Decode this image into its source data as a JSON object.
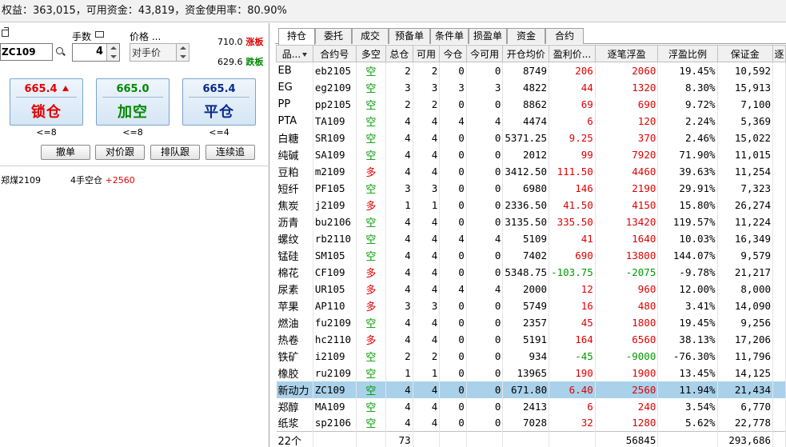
{
  "account_bar": "权益：363,015，可用资金：43,819，资金使用率：80.90%",
  "order": {
    "code": "ZC109",
    "qty_label": "手数",
    "qty": "4",
    "price_label": "价格 ...",
    "price_mode": "对手价",
    "limit_up_price": "710.0",
    "limit_up_tag": "涨板",
    "limit_down_price": "629.6",
    "limit_down_tag": "跌板",
    "buttons": [
      {
        "price": "665.4",
        "action": "锁仓",
        "cond": "<=8"
      },
      {
        "price": "665.0",
        "action": "加空",
        "cond": "<=8"
      },
      {
        "price": "665.4",
        "action": "平仓",
        "cond": "<=4"
      }
    ],
    "small_buttons": [
      "撤单",
      "对价跟",
      "排队跟",
      "连续追"
    ],
    "position_line": {
      "name": "郑煤2109",
      "desc": "4手空仓",
      "pnl": "+2560"
    }
  },
  "tabs": [
    "持仓",
    "委托",
    "成交",
    "预备单",
    "条件单",
    "损盈单",
    "资金",
    "合约"
  ],
  "columns": [
    "品...",
    "合约号",
    "多空",
    "总仓",
    "可用",
    "今仓",
    "今可用",
    "开仓均价",
    "盈利价...",
    "逐笔浮盈",
    "浮盈比例",
    "保证金",
    "逐"
  ],
  "rows": [
    [
      "EB",
      "eb2105",
      "空",
      "2",
      "2",
      "0",
      "0",
      "8749",
      "206",
      "2060",
      "19.45%",
      "10,592"
    ],
    [
      "EG",
      "eg2109",
      "空",
      "3",
      "3",
      "3",
      "3",
      "4822",
      "44",
      "1320",
      "8.30%",
      "15,913"
    ],
    [
      "PP",
      "pp2105",
      "空",
      "2",
      "2",
      "0",
      "0",
      "8862",
      "69",
      "690",
      "9.72%",
      "7,100"
    ],
    [
      "PTA",
      "TA109",
      "空",
      "4",
      "4",
      "4",
      "4",
      "4474",
      "6",
      "120",
      "2.24%",
      "5,369"
    ],
    [
      "白糖",
      "SR109",
      "空",
      "4",
      "4",
      "0",
      "0",
      "5371.25",
      "9.25",
      "370",
      "2.46%",
      "15,022"
    ],
    [
      "纯碱",
      "SA109",
      "空",
      "4",
      "4",
      "0",
      "0",
      "2012",
      "99",
      "7920",
      "71.90%",
      "11,015"
    ],
    [
      "豆粕",
      "m2109",
      "多",
      "4",
      "4",
      "0",
      "0",
      "3412.50",
      "111.50",
      "4460",
      "39.63%",
      "11,254"
    ],
    [
      "短纤",
      "PF105",
      "空",
      "3",
      "3",
      "0",
      "0",
      "6980",
      "146",
      "2190",
      "29.91%",
      "7,323"
    ],
    [
      "焦炭",
      "j2109",
      "多",
      "1",
      "1",
      "0",
      "0",
      "2336.50",
      "41.50",
      "4150",
      "15.80%",
      "26,274"
    ],
    [
      "沥青",
      "bu2106",
      "空",
      "4",
      "4",
      "0",
      "0",
      "3135.50",
      "335.50",
      "13420",
      "119.57%",
      "11,224"
    ],
    [
      "螺纹",
      "rb2110",
      "空",
      "4",
      "4",
      "4",
      "4",
      "5109",
      "41",
      "1640",
      "10.03%",
      "16,349"
    ],
    [
      "锰硅",
      "SM105",
      "空",
      "4",
      "4",
      "0",
      "0",
      "7402",
      "690",
      "13800",
      "144.07%",
      "9,579"
    ],
    [
      "棉花",
      "CF109",
      "多",
      "4",
      "4",
      "0",
      "0",
      "5348.75",
      "-103.75",
      "-2075",
      "-9.78%",
      "21,217"
    ],
    [
      "尿素",
      "UR105",
      "多",
      "4",
      "4",
      "4",
      "4",
      "2000",
      "12",
      "960",
      "12.00%",
      "8,000"
    ],
    [
      "苹果",
      "AP110",
      "多",
      "3",
      "3",
      "0",
      "0",
      "5749",
      "16",
      "480",
      "3.41%",
      "14,090"
    ],
    [
      "燃油",
      "fu2109",
      "空",
      "4",
      "4",
      "0",
      "0",
      "2357",
      "45",
      "1800",
      "19.45%",
      "9,256"
    ],
    [
      "热卷",
      "hc2110",
      "多",
      "4",
      "4",
      "0",
      "0",
      "5191",
      "164",
      "6560",
      "38.13%",
      "17,206"
    ],
    [
      "铁矿",
      "i2109",
      "空",
      "2",
      "2",
      "0",
      "0",
      "934",
      "-45",
      "-9000",
      "-76.30%",
      "11,796"
    ],
    [
      "橡胶",
      "ru2109",
      "空",
      "1",
      "1",
      "0",
      "0",
      "13965",
      "190",
      "1900",
      "13.45%",
      "14,125"
    ],
    [
      "新动力",
      "ZC109",
      "空",
      "4",
      "4",
      "0",
      "0",
      "671.80",
      "6.40",
      "2560",
      "11.94%",
      "21,434"
    ],
    [
      "郑醇",
      "MA109",
      "空",
      "4",
      "4",
      "0",
      "0",
      "2413",
      "6",
      "240",
      "3.54%",
      "6,770"
    ],
    [
      "纸浆",
      "sp2106",
      "空",
      "4",
      "4",
      "0",
      "0",
      "7028",
      "32",
      "1280",
      "5.62%",
      "22,778"
    ]
  ],
  "selected_row": 19,
  "totals": {
    "count": "22个",
    "total_pos": "73",
    "float_pnl": "56845",
    "margin": "293,686"
  },
  "colors": {
    "long": "#e00000",
    "short": "#009900",
    "selected": "#a9d1ea"
  }
}
